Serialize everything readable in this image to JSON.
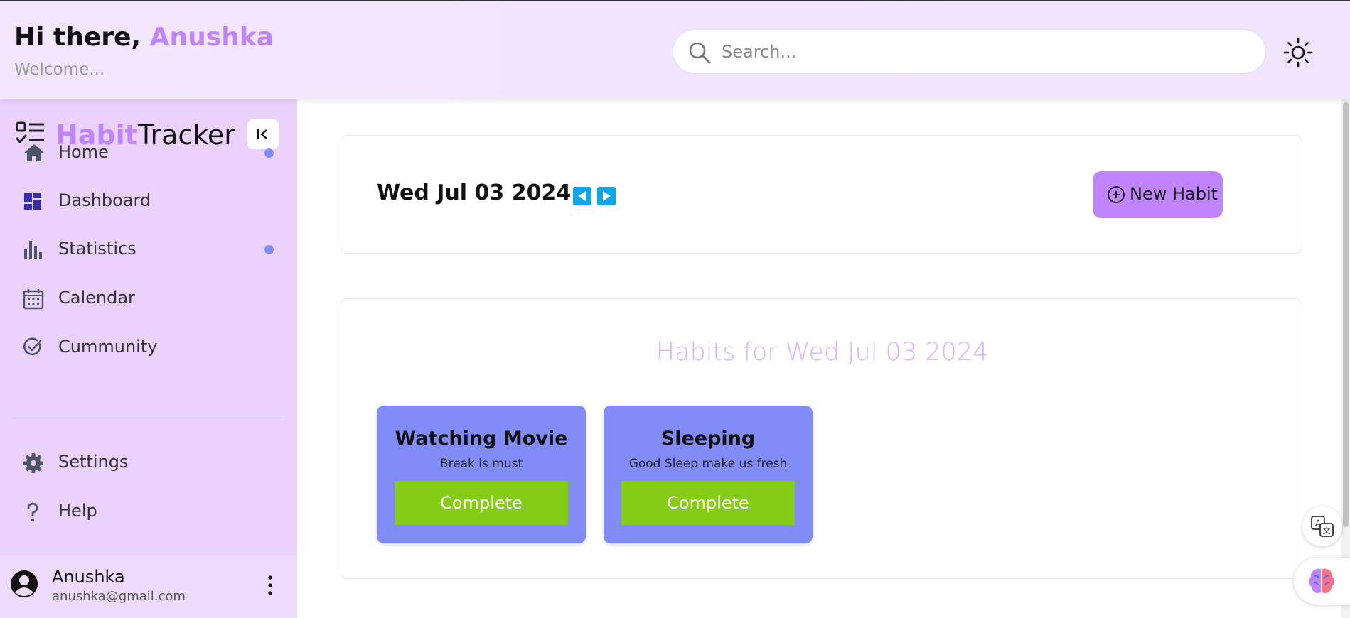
{
  "header": {
    "greeting_prefix": "Hi there, ",
    "user_name": "Anushka",
    "welcome": "Welcome...",
    "search_placeholder": "Search...",
    "theme_icon": "sun-icon"
  },
  "sidebar": {
    "brand_highlight": "Habit",
    "brand_rest": "Tracker",
    "brand_icon": "checklist-icon",
    "collapse_icon": "collapse-left-icon",
    "items": [
      {
        "label": "Home",
        "icon": "home-icon",
        "dot": true
      },
      {
        "label": "Dashboard",
        "icon": "dashboard-icon",
        "dot": false
      },
      {
        "label": "Statistics",
        "icon": "bar-chart-icon",
        "dot": true
      },
      {
        "label": "Calendar",
        "icon": "calendar-icon",
        "dot": false
      },
      {
        "label": "Cummunity",
        "icon": "check-circle-icon",
        "dot": false
      }
    ],
    "bottom_items": [
      {
        "label": "Settings",
        "icon": "gear-icon"
      },
      {
        "label": "Help",
        "icon": "question-icon"
      }
    ],
    "user": {
      "name": "Anushka",
      "email": "anushka@gmail.com"
    }
  },
  "main": {
    "date": "Wed Jul 03 2024",
    "new_habit_label": "New Habit",
    "habits_title": "Habits for Wed Jul 03 2024",
    "habits": [
      {
        "title": "Watching Movie",
        "description": "Break is must",
        "button": "Complete"
      },
      {
        "title": "Sleeping",
        "description": "Good Sleep make us fresh",
        "button": "Complete"
      }
    ]
  },
  "colors": {
    "accent": "#c084fc",
    "sidebar_bg": "#ead2fd",
    "habit_card": "#818cf8",
    "complete_button": "#84cc16",
    "nav_arrows": "#0ea5e9"
  }
}
